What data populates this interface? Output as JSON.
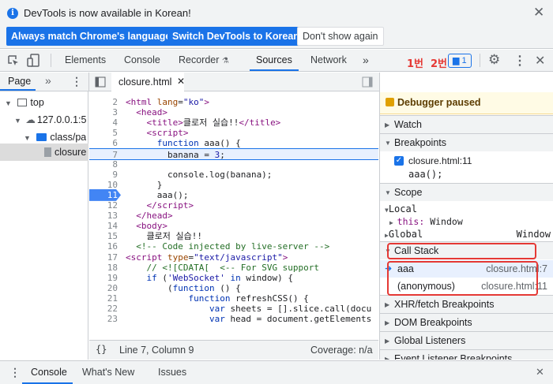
{
  "infobar": {
    "message": "DevTools is now available in Korean!",
    "btn_match": "Always match Chrome's language",
    "btn_switch": "Switch DevTools to Korean",
    "btn_dismiss": "Don't show again"
  },
  "tabs": {
    "elements": "Elements",
    "console": "Console",
    "recorder": "Recorder",
    "sources": "Sources",
    "network": "Network",
    "more": "»",
    "badge_count": "1"
  },
  "annotations": {
    "label1": "1번",
    "label2": "2번"
  },
  "navigator": {
    "tab": "Page",
    "more": "»",
    "top": "top",
    "host": "127.0.0.1:5",
    "folder": "class/pa",
    "file": "closure"
  },
  "editor": {
    "tab_file": "closure.html",
    "lines": [
      {
        "n": "2",
        "html": "<span class=\"tg\">&lt;html</span> <span class=\"at\">lang</span>=<span class=\"av\">\"ko\"</span><span class=\"tg\">&gt;</span>"
      },
      {
        "n": "3",
        "html": "  <span class=\"tg\">&lt;head&gt;</span>"
      },
      {
        "n": "4",
        "html": "    <span class=\"tg\">&lt;title&gt;</span>클로저 실습!!<span class=\"tg\">&lt;/title&gt;</span>"
      },
      {
        "n": "5",
        "html": "    <span class=\"tg\">&lt;script&gt;</span>"
      },
      {
        "n": "6",
        "html": "      <span class=\"kw\">function</span> aaa() {"
      },
      {
        "n": "7",
        "html": "        banana = <span class=\"st\">3</span>;",
        "highlight": true
      },
      {
        "n": "8",
        "html": ""
      },
      {
        "n": "9",
        "html": "        console.log(banana);"
      },
      {
        "n": "10",
        "html": "      }"
      },
      {
        "n": "11",
        "html": "      aaa();",
        "breakpoint": true
      },
      {
        "n": "12",
        "html": "    <span class=\"tg\">&lt;/script&gt;</span>"
      },
      {
        "n": "13",
        "html": "  <span class=\"tg\">&lt;/head&gt;</span>"
      },
      {
        "n": "14",
        "html": "  <span class=\"tg\">&lt;body&gt;</span>"
      },
      {
        "n": "15",
        "html": "    클로저 실습!!"
      },
      {
        "n": "16",
        "html": "  <span class=\"cm\">&lt;!-- Code injected by live-server --&gt;</span>"
      },
      {
        "n": "17",
        "html": "<span class=\"tg\">&lt;script</span> <span class=\"at\">type</span>=<span class=\"av\">\"text/javascript\"</span><span class=\"tg\">&gt;</span>"
      },
      {
        "n": "18",
        "html": "    <span class=\"cm\">// &lt;![CDATA[  &lt;-- For SVG support</span>"
      },
      {
        "n": "19",
        "html": "    <span class=\"kw\">if</span> (<span class=\"st\">'WebSocket'</span> <span class=\"kw\">in</span> window) {"
      },
      {
        "n": "20",
        "html": "        (<span class=\"kw\">function</span> () {"
      },
      {
        "n": "21",
        "html": "            <span class=\"kw\">function</span> refreshCSS() {"
      },
      {
        "n": "22",
        "html": "                <span class=\"kw\">var</span> sheets = [].slice.call(docu"
      },
      {
        "n": "23",
        "html": "                <span class=\"kw\">var</span> head = document.getElements"
      }
    ],
    "status_position": "Line 7, Column 9",
    "status_coverage": "Coverage: n/a"
  },
  "debugger": {
    "paused": "Debugger paused",
    "watch": "Watch",
    "breakpoints": "Breakpoints",
    "bp_file": "closure.html:11",
    "bp_code": "aaa();",
    "scope": "Scope",
    "local": "Local",
    "this_label": "this:",
    "this_value": "Window",
    "global": "Global",
    "global_value": "Window",
    "call_stack": "Call Stack",
    "frame1_name": "aaa",
    "frame1_loc": "closure.html:7",
    "frame2_name": "(anonymous)",
    "frame2_loc": "closure.html:11",
    "xhr": "XHR/fetch Breakpoints",
    "dom": "DOM Breakpoints",
    "listeners": "Global Listeners",
    "event": "Event Listener Breakpoints"
  },
  "drawer": {
    "console": "Console",
    "whats_new": "What's New",
    "issues": "Issues"
  }
}
